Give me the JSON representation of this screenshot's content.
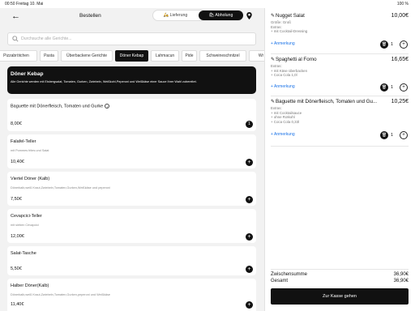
{
  "status": {
    "left": "00:50  Freitag 10. Mai",
    "right": "100 %"
  },
  "header": {
    "back_icon": "arrow-left-icon",
    "title": "Bestellen",
    "tabs": [
      "Lieferung",
      "Abholung"
    ],
    "active_tab": "Abholung"
  },
  "search": {
    "placeholder": "Durchsuche alle Gerichte..."
  },
  "categories": [
    "Pizzabrötchen",
    "Pasta",
    "Überbackene Gerichte",
    "Döner Kebap",
    "Lahmacun",
    "Pide",
    "Schweineschnitzel",
    "Wr"
  ],
  "active_category": "Döner Kebap",
  "banner": {
    "title": "Döner Kebap",
    "desc": "Alle Gerichte werden mit Eisbergsalat, Tomaten, Gurken, Zwiebeln, Weißkohl,Peperoni und Weißkäse einer Sauce Ihrer Wahl zubereitet."
  },
  "menu_items": [
    {
      "name": "Baguette mit Dönerfleisch, Tomaten und Gurke",
      "desc": "",
      "price": "8,00€",
      "in_cart": "1"
    },
    {
      "name": "Falafel-Teller",
      "desc": "mit Pommes frites und Salat",
      "price": "10,40€",
      "in_cart": ""
    },
    {
      "name": "Viertel Döner (Kalb)",
      "desc": "Dönerkalb,weiß Kraut,Zwiebeln,Tomaten,Gurken,Weißkäse und peperoni",
      "price": "7,50€",
      "in_cart": ""
    },
    {
      "name": "Cevapcici-Teller",
      "desc": "mit sieben Cevapcici",
      "price": "12,00€",
      "in_cart": ""
    },
    {
      "name": "Salat-Tasche",
      "desc": "",
      "price": "5,50€",
      "in_cart": ""
    },
    {
      "name": "Halber Döner(Kalb)",
      "desc": "Dönerkalb,weiß Kraut,Zwiebeln,Tomaten,Gurken,peperoni und Weißkäse",
      "price": "11,40€",
      "in_cart": ""
    }
  ],
  "cart": {
    "items": [
      {
        "name": "Nugget Salat",
        "price": "10,00€",
        "details": [
          "Größe: Groß",
          "Extras:",
          "+ mit Cocktail-Dressing"
        ],
        "note": "+ Anmerkung",
        "qty": "1"
      },
      {
        "name": "Spaghetti al Forno",
        "price": "16,65€",
        "details": [
          "Extras:",
          "+ mit Käse überbacken",
          "+ Coca Cola 1,0l"
        ],
        "note": "+ Anmerkung",
        "qty": "1"
      },
      {
        "name": "Baguette mit Dönerfleisch, Tomaten und Gu...",
        "price": "10,25€",
        "details": [
          "Extras:",
          "+ mit Cocktailsauce",
          "+ ohne Rotkohl",
          "+ Coca Cola 0,33l"
        ],
        "note": "+ Anmerkung",
        "qty": "1"
      }
    ],
    "subtotal_label": "Zwischensumme",
    "subtotal": "36,90€",
    "total_label": "Gesamt",
    "total": "36,90€",
    "checkout": "Zur Kasse gehen"
  }
}
